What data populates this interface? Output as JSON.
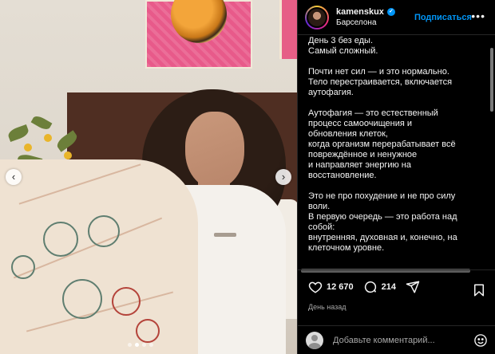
{
  "post": {
    "author": {
      "username": "kamenskux",
      "location": "Барселона",
      "follow_label": "Подписаться",
      "more_label": "•••"
    },
    "caption": [
      "День 3 без еды.",
      "Самый сложный.",
      "",
      "Почти нет сил — и это нормально.",
      "Тело перестраивается, включается",
      "аутофагия.",
      "",
      "Аутофагия — это естественный",
      "процесс самоочищения и",
      "обновления клеток,",
      "когда организм перерабатывает всё",
      "повреждённое и ненужное",
      "и направляет энергию на",
      "восстановление.",
      "",
      "Это не про похудение и не про силу",
      "воли.",
      "В первую очередь — это работа над",
      "собой:",
      "внутренняя, духовная и, конечно, на",
      "клеточном уровне."
    ],
    "likes": "12 670",
    "comments": "214",
    "timestamp": "День назад",
    "comment_placeholder": "Добавьте комментарий...",
    "media_nav": {
      "prev": "‹",
      "next": "›"
    },
    "carousel": {
      "count": 4,
      "active_index": 1
    }
  },
  "colors": {
    "accent": "#0095f6",
    "background": "#000000",
    "text": "#f5f5f5",
    "muted": "#a8a8a8"
  },
  "icons": [
    "heart-icon",
    "comment-icon",
    "share-icon",
    "bookmark-icon",
    "emoji-icon",
    "verified-icon",
    "more-icon"
  ]
}
